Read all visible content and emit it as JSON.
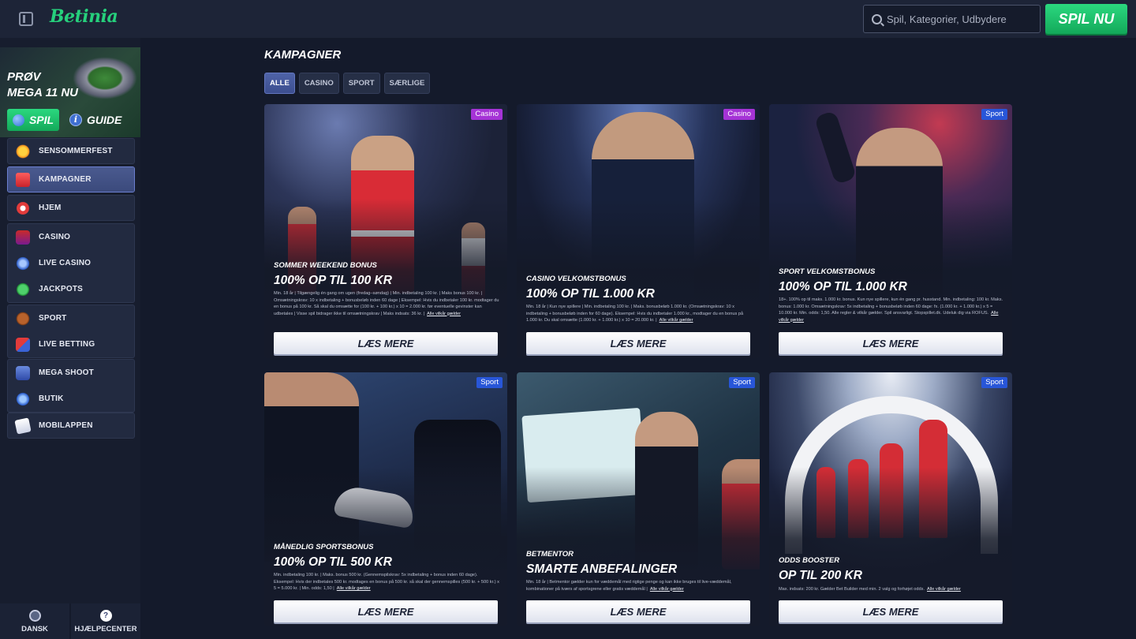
{
  "header": {
    "logo": "Betinia",
    "search_placeholder": "Spil, Kategorier, Udbydere",
    "play_now": "SPIL NU"
  },
  "sidebar": {
    "promo": {
      "title": "PRØV MEGA 11 NU",
      "play": "SPIL",
      "guide": "GUIDE"
    },
    "items": [
      {
        "label": "SENSOMMERFEST",
        "icon": "sun-icon"
      },
      {
        "label": "KAMPAGNER",
        "icon": "gift-icon",
        "active": true
      },
      {
        "label": "HJEM",
        "icon": "home-icon"
      },
      {
        "label": "CASINO",
        "icon": "slot-machine-icon"
      },
      {
        "label": "LIVE CASINO",
        "icon": "live-casino-icon"
      },
      {
        "label": "JACKPOTS",
        "icon": "clover-icon"
      },
      {
        "label": "SPORT",
        "icon": "football-icon"
      },
      {
        "label": "LIVE BETTING",
        "icon": "live-betting-icon"
      },
      {
        "label": "MEGA SHOOT",
        "icon": "mega-shoot-icon"
      },
      {
        "label": "BUTIK",
        "icon": "shop-icon"
      },
      {
        "label": "MOBILAPPEN",
        "icon": "phone-icon"
      }
    ],
    "footer": {
      "language": "DANSK",
      "help": "HJÆLPECENTER"
    }
  },
  "main": {
    "title": "KAMPAGNER",
    "tabs": [
      {
        "label": "ALLE",
        "active": true
      },
      {
        "label": "CASINO"
      },
      {
        "label": "SPORT"
      },
      {
        "label": "SÆRLIGE"
      }
    ],
    "read_more": "LÆS MERE",
    "terms_link": "Alle vilkår gælder",
    "cards": [
      {
        "badge": "Casino",
        "subtitle": "SOMMER WEEKEND BONUS",
        "title": "100% OP TIL 100 KR",
        "terms": "Min. 18 år | Tilgængelig én gang om ugen (fredag–søndag) | Min. indbetaling 100 kr. | Maks bonus 100 kr. | Omsætningskrav: 10 x indbetaling + bonusbeløb inden 60 dage | Eksempel: Hvis du indbetaler 100 kr. modtager du en bonus på 100 kr. Så skal du omsætte for (100 kr. + 100 kr.) x 10 = 2.000 kr. før eventuelle gevinster kan udbetales | Visse spil bidrager ikke til omsætningskrav | Maks indsats: 36 kr. |"
      },
      {
        "badge": "Casino",
        "subtitle": "CASINO VELKOMSTBONUS",
        "title": "100% OP TIL 1.000 KR",
        "terms": "Min. 18 år | Kun nye spillere | Min. indbetaling 100 kr. | Maks. bonusbeløb 1.000 kr. (Omsætningskrav: 10 x indbetaling + bonusbeløb inden for 60 dage). Eksempel: Hvis du indbetaler 1.000 kr., modtager du en bonus på 1.000 kr. Du skal omsætte (1.000 kr. + 1.000 kr.) x 10 = 20.000 kr. |"
      },
      {
        "badge": "Sport",
        "subtitle": "SPORT VELKOMSTBONUS",
        "title": "100% OP TIL 1.000 KR",
        "terms": "18+. 100% op til maks. 1.000 kr. bonus. Kun nye spillere, kun én gang pr. husstand. Min. indbetaling: 100 kr. Maks. bonus: 1.000 kr. Omsætningskrav: 5x indbetaling + bonusbeløb inden 60 dage: fx. (1.000 kr. + 1.000 kr.) x 5 = 10.000 kr. Min. odds: 1,50. Alle regler & vilkår gælder. Spil ansvarligt. Stopspillet.dk. Udeluk dig via ROFUS."
      },
      {
        "badge": "Sport",
        "subtitle": "MÅNEDLIG SPORTSBONUS",
        "title": "100% OP TIL 500 KR",
        "terms": "Min. indbetaling 100 kr. | Maks. bonus 500 kr. (Gennemspilskrav: 5x indbetaling + bonus inden 60 dage). Eksempel: Hvis der indbetales 500 kr. modtages en bonus på 500 kr. så skal der gennemspilles (500 kr. + 500 kr.) x 5 = 5.000 kr. | Min. odds: 1,50 |"
      },
      {
        "badge": "Sport",
        "subtitle": "BETMENTOR",
        "title": "SMARTE ANBEFALINGER",
        "terms": "Min. 18 år | Betmentor gælder kun for væddemål med rigtige penge og kan ikke bruges til live-væddemål, kombinationer på tværs af sportsgrene eller gratis væddemål |"
      },
      {
        "badge": "Sport",
        "subtitle": "ODDS BOOSTER",
        "title": "OP TIL 200 KR",
        "terms": "Max. indsats: 200 kr. Gælder Bet Builder med min. 2 valg og forhøjet odds."
      }
    ]
  },
  "colors": {
    "accent_green": "#26d07c",
    "casino_badge": "#a533d6",
    "sport_badge": "#2856d8",
    "background": "#141a2b"
  }
}
